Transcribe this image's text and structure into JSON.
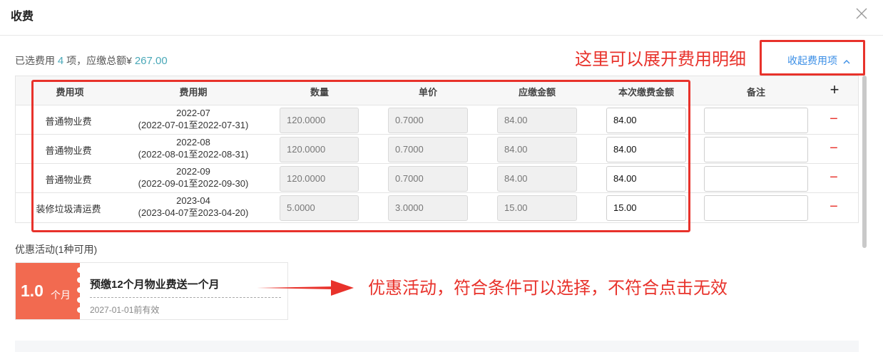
{
  "dialog": {
    "title": "收费"
  },
  "summary": {
    "prefix": "已选费用",
    "count": "4",
    "middle": "项，应缴总额¥",
    "total": "267.00"
  },
  "annotations": {
    "expand_note": "这里可以展开费用明细",
    "promo_note": "优惠活动，符合条件可以选择，不符合点击无效"
  },
  "collapse": {
    "label": "收起费用项",
    "icon": "chevron-up-icon"
  },
  "table": {
    "headers": {
      "item": "费用项",
      "period": "费用期",
      "qty": "数量",
      "price": "单价",
      "due": "应缴金额",
      "pay": "本次缴费金额",
      "remark": "备注",
      "add": "+"
    },
    "rows": [
      {
        "item": "普通物业费",
        "period_month": "2022-07",
        "period_range": "(2022-07-01至2022-07-31)",
        "qty": "120.0000",
        "price": "0.7000",
        "due": "84.00",
        "pay": "84.00",
        "remark": ""
      },
      {
        "item": "普通物业费",
        "period_month": "2022-08",
        "period_range": "(2022-08-01至2022-08-31)",
        "qty": "120.0000",
        "price": "0.7000",
        "due": "84.00",
        "pay": "84.00",
        "remark": ""
      },
      {
        "item": "普通物业费",
        "period_month": "2022-09",
        "period_range": "(2022-09-01至2022-09-30)",
        "qty": "120.0000",
        "price": "0.7000",
        "due": "84.00",
        "pay": "84.00",
        "remark": ""
      },
      {
        "item": "装修垃圾清运费",
        "period_month": "2023-04",
        "period_range": "(2023-04-07至2023-04-20)",
        "qty": "5.0000",
        "price": "3.0000",
        "due": "15.00",
        "pay": "15.00",
        "remark": ""
      }
    ],
    "remove_symbol": "−"
  },
  "promotion": {
    "title": "优惠活动(1种可用)",
    "coupon": {
      "amount": "1.0",
      "unit": "个月",
      "name": "预缴12个月物业费送一个月",
      "valid": "2027-01-01前有效"
    }
  },
  "colors": {
    "accent_red": "#e8322b",
    "link_blue": "#3a8ee6",
    "total_teal": "#4aa8b8",
    "coupon_orange": "#f26a50"
  }
}
